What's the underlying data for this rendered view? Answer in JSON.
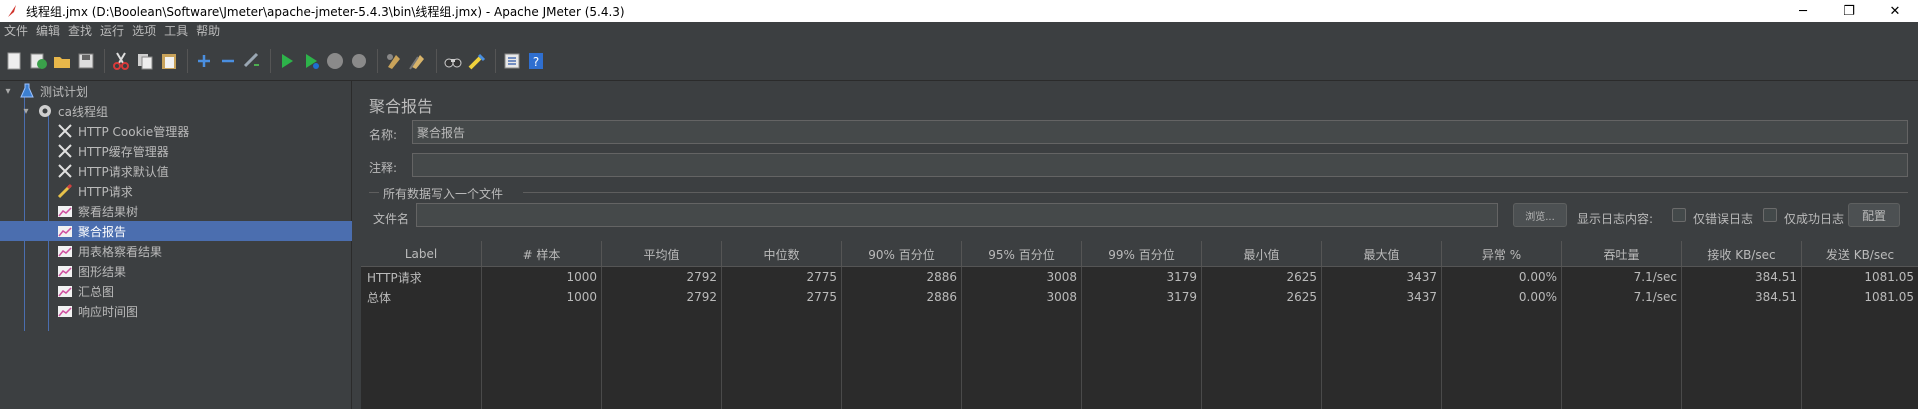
{
  "window": {
    "title": "线程组.jmx (D:\\Boolean\\Software\\Jmeter\\apache-jmeter-5.4.3\\bin\\线程组.jmx) - Apache JMeter (5.4.3)",
    "min_glyph": "─",
    "max_glyph": "❐",
    "close_glyph": "✕"
  },
  "menu": [
    "文件",
    "编辑",
    "查找",
    "运行",
    "选项",
    "工具",
    "帮助"
  ],
  "toolbar": {
    "icons": [
      "new-icon",
      "templates-icon",
      "open-icon",
      "save-icon",
      "cut-icon",
      "copy-icon",
      "paste-icon",
      "expand-icon",
      "collapse-icon",
      "toggle-icon",
      "start-icon",
      "start-no-pause-icon",
      "stop-icon",
      "shutdown-icon",
      "clear-icon",
      "clear-all-icon",
      "search-icon",
      "reset-search-icon",
      "function-helper-icon",
      "help-icon"
    ]
  },
  "tree": {
    "root": "测试计划",
    "thread_group": "ca线程组",
    "items": [
      {
        "label": "HTTP Cookie管理器",
        "icon": "wrench-icon"
      },
      {
        "label": "HTTP缓存管理器",
        "icon": "wrench-icon"
      },
      {
        "label": "HTTP请求默认值",
        "icon": "wrench-icon"
      },
      {
        "label": "HTTP请求",
        "icon": "pen-icon"
      },
      {
        "label": "察看结果树",
        "icon": "chart-icon"
      },
      {
        "label": "聚合报告",
        "icon": "chart-icon"
      },
      {
        "label": "用表格察看结果",
        "icon": "chart-icon"
      },
      {
        "label": "图形结果",
        "icon": "chart-icon"
      },
      {
        "label": "汇总图",
        "icon": "chart-icon"
      },
      {
        "label": "响应时间图",
        "icon": "chart-icon"
      }
    ],
    "selected": "聚合报告"
  },
  "panel": {
    "title": "聚合报告",
    "name_label": "名称:",
    "name_value": "聚合报告",
    "comment_label": "注释:",
    "comment_value": "",
    "file_group_label": "所有数据写入一个文件",
    "file_label": "文件名",
    "file_value": "",
    "browse_label": "浏览...",
    "log_label": "显示日志内容:",
    "errors_only_label": "仅错误日志",
    "success_only_label": "仅成功日志",
    "config_label": "配置"
  },
  "table": {
    "headers": [
      "Label",
      "# 样本",
      "平均值",
      "中位数",
      "90% 百分位",
      "95% 百分位",
      "99% 百分位",
      "最小值",
      "最大值",
      "异常 %",
      "吞吐量",
      "接收 KB/sec",
      "发送 KB/sec"
    ],
    "rows": [
      [
        "HTTP请求",
        "1000",
        "2792",
        "2775",
        "2886",
        "3008",
        "3179",
        "2625",
        "3437",
        "0.00%",
        "7.1/sec",
        "384.51",
        "1081.05"
      ],
      [
        "总体",
        "1000",
        "2792",
        "2775",
        "2886",
        "3008",
        "3179",
        "2625",
        "3437",
        "0.00%",
        "7.1/sec",
        "384.51",
        "1081.05"
      ]
    ]
  }
}
